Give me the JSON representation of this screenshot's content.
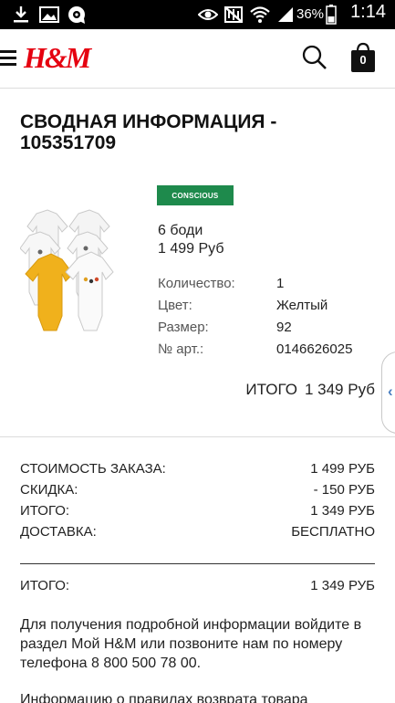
{
  "status_bar": {
    "battery_percent": "36%",
    "time": "1:14",
    "icons": [
      "download-icon",
      "image-icon",
      "app-icon",
      "eye-icon",
      "mute-icon",
      "wifi-icon",
      "signal-icon",
      "battery-icon"
    ]
  },
  "header": {
    "logo": "H&M",
    "menu_icon": "hamburger-icon",
    "search_icon": "search-icon",
    "bag_icon": "shopping-bag-icon",
    "bag_count": "0"
  },
  "page": {
    "title": "СВОДНАЯ ИНФОРМАЦИЯ - 105351709"
  },
  "product": {
    "badge": "CONSCIOUS",
    "name": "6 боди",
    "price": "1 499 Руб",
    "attributes": [
      {
        "label": "Количество:",
        "value": "1"
      },
      {
        "label": "Цвет:",
        "value": "Желтый"
      },
      {
        "label": "Размер:",
        "value": "92"
      },
      {
        "label": "№ арт.:",
        "value": "0146626025"
      }
    ],
    "total_label": "ИТОГО",
    "total_value": "1 349 Руб"
  },
  "summary": {
    "rows": [
      {
        "label": "СТОИМОСТЬ ЗАКАЗА:",
        "value": "1 499 РУБ"
      },
      {
        "label": "СКИДКА:",
        "value": "- 150 РУБ"
      },
      {
        "label": "ИТОГО:",
        "value": "1 349 РУБ"
      },
      {
        "label": "ДОСТАВКА:",
        "value": "БЕСПЛАТНО"
      }
    ],
    "grand_total_label": "ИТОГО:",
    "grand_total_value": "1 349 РУБ"
  },
  "info": {
    "text": "Для получения подробной информации войдите в раздел Мой H&M или позвоните нам по номеру телефона 8 800 500 78 00.",
    "text2": "Информацию о правилах возврата товара"
  },
  "colors": {
    "brand_red": "#e50010",
    "badge_green": "#1e8a4c",
    "handle_blue": "#4a7fc1"
  }
}
